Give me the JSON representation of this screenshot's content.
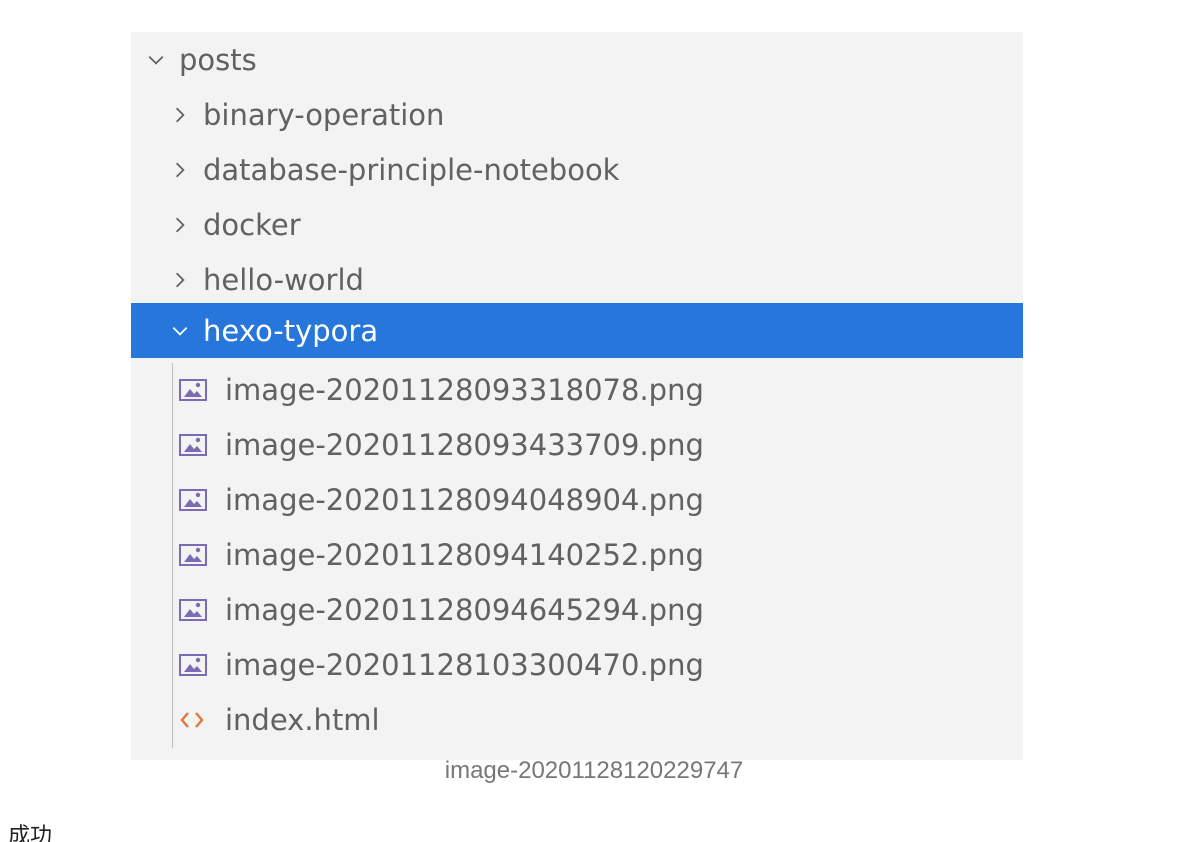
{
  "explorer": {
    "root_folder": {
      "label": "posts",
      "expanded": true
    },
    "folders": [
      {
        "label": "binary-operation",
        "expanded": false
      },
      {
        "label": "database-principle-notebook",
        "expanded": false
      },
      {
        "label": "docker",
        "expanded": false
      },
      {
        "label": "hello-world",
        "expanded": false
      },
      {
        "label": "hexo-typora",
        "expanded": true,
        "selected": true
      }
    ],
    "files": [
      {
        "label": "image-20201128093318078.png",
        "icon": "image-file-icon"
      },
      {
        "label": "image-20201128093433709.png",
        "icon": "image-file-icon"
      },
      {
        "label": "image-20201128094048904.png",
        "icon": "image-file-icon"
      },
      {
        "label": "image-20201128094140252.png",
        "icon": "image-file-icon"
      },
      {
        "label": "image-20201128094645294.png",
        "icon": "image-file-icon"
      },
      {
        "label": "image-20201128103300470.png",
        "icon": "image-file-icon"
      },
      {
        "label": "index.html",
        "icon": "html-code-icon"
      }
    ],
    "colors": {
      "background": "#f3f3f3",
      "selection": "#2676dc",
      "text": "#616161",
      "image_icon": "#7b6bb5",
      "html_icon": "#e0793a"
    }
  },
  "caption": "image-20201128120229747",
  "bottom_text": "成功"
}
